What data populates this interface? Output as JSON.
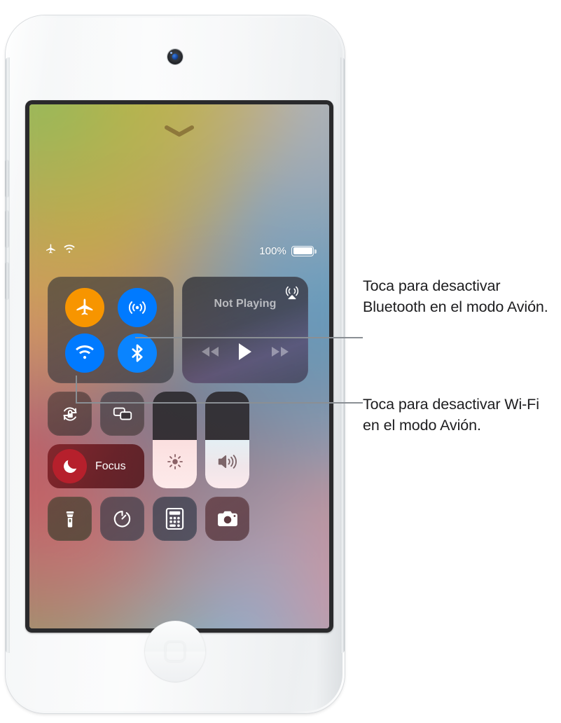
{
  "device": {
    "name": "iPod touch",
    "camera_label": "front-camera",
    "home_button_label": "Home"
  },
  "screen": {
    "grabber_label": "Close Control Center",
    "status_bar": {
      "airplane_icon": "airplane-mode-icon",
      "wifi_icon": "wifi-icon",
      "battery_percent": "100%",
      "battery_icon": "battery-full-icon"
    },
    "control_center": {
      "connectivity": {
        "name": "Network settings",
        "buttons": [
          {
            "id": "airplane-mode",
            "label": "Airplane Mode",
            "state": "on",
            "color": "#f79500",
            "icon": "airplane-icon"
          },
          {
            "id": "airdrop",
            "label": "AirDrop",
            "state": "on",
            "color": "#007aff",
            "icon": "airdrop-icon"
          },
          {
            "id": "wifi",
            "label": "Wi-Fi",
            "state": "on",
            "color": "#007aff",
            "icon": "wifi-icon"
          },
          {
            "id": "bluetooth",
            "label": "Bluetooth",
            "state": "on",
            "color": "#0a84ff",
            "icon": "bluetooth-icon"
          }
        ]
      },
      "media": {
        "title": "Not Playing",
        "airplay_icon": "airplay-audio-icon",
        "controls": [
          {
            "id": "rewind",
            "label": "Rewind",
            "icon": "rewind-icon"
          },
          {
            "id": "play",
            "label": "Play",
            "icon": "play-icon"
          },
          {
            "id": "forward",
            "label": "Forward",
            "icon": "fast-forward-icon"
          }
        ]
      },
      "toggles": [
        {
          "id": "rotation-lock",
          "label": "Portrait Orientation Lock",
          "icon": "rotation-lock-icon"
        },
        {
          "id": "screen-mirroring",
          "label": "Screen Mirroring",
          "icon": "screen-mirroring-icon"
        }
      ],
      "focus": {
        "id": "focus",
        "label": "Focus",
        "icon": "moon-icon",
        "accent": "#b6202c"
      },
      "sliders": [
        {
          "id": "brightness",
          "label": "Display Brightness",
          "icon": "brightness-icon",
          "value": 50
        },
        {
          "id": "volume",
          "label": "Volume",
          "icon": "volume-icon",
          "value": 50
        }
      ],
      "shortcuts": [
        {
          "id": "flashlight",
          "label": "Flashlight",
          "icon": "flashlight-icon"
        },
        {
          "id": "timer",
          "label": "Timer",
          "icon": "timer-icon"
        },
        {
          "id": "calculator",
          "label": "Calculator",
          "icon": "calculator-icon"
        },
        {
          "id": "camera",
          "label": "Camera",
          "icon": "camera-icon"
        }
      ]
    }
  },
  "callouts": [
    {
      "id": "bluetooth-callout",
      "text": "Toca para desactivar Bluetooth en el modo Avión."
    },
    {
      "id": "wifi-callout",
      "text": "Toca para desactivar Wi-Fi en el modo Avión."
    }
  ],
  "colors": {
    "leader_line": "#8a8f94",
    "callout_text": "#1d1d1f",
    "orange": "#f79500",
    "blue": "#007aff"
  }
}
